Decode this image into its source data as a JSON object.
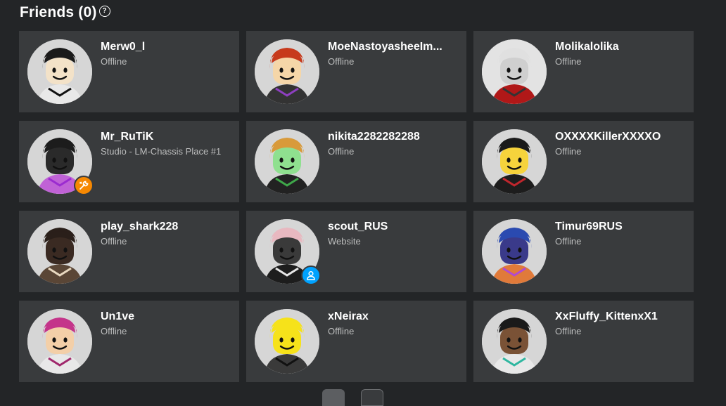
{
  "header": {
    "title": "Friends (0)",
    "help_glyph": "?"
  },
  "friends": [
    {
      "name": "Merw0_l",
      "status": "Offline",
      "badge": null,
      "avatar": {
        "bg": "#d6d6d6",
        "skin": "#f3e2c8",
        "hair": "#1a1a1a",
        "shirt": "#e8e8e8",
        "accent": "#111111"
      }
    },
    {
      "name": "MoeNastoyasheeIm...",
      "status": "Offline",
      "badge": null,
      "avatar": {
        "bg": "#d6d6d6",
        "skin": "#f5d6a8",
        "hair": "#c73a1c",
        "shirt": "#333333",
        "accent": "#8e3fc0"
      }
    },
    {
      "name": "Molikalolika",
      "status": "Offline",
      "badge": null,
      "avatar": {
        "bg": "#e3e3e3",
        "skin": "#cfcfcf",
        "hair": "#e0e0e0",
        "shirt": "#b01818",
        "accent": "#333333"
      }
    },
    {
      "name": "Mr_RuTiK",
      "status": "Studio - LM-Chassis Place #1",
      "badge": "studio",
      "avatar": {
        "bg": "#d6d6d6",
        "skin": "#2a2a2a",
        "hair": "#1c1c1c",
        "shirt": "#c062d6",
        "accent": "#9b2bd0"
      }
    },
    {
      "name": "nikita2282282288",
      "status": "Offline",
      "badge": null,
      "avatar": {
        "bg": "#d6d6d6",
        "skin": "#8fe08f",
        "hair": "#d89a3a",
        "shirt": "#222222",
        "accent": "#3fa84a"
      }
    },
    {
      "name": "OXXXXKillerXXXXO",
      "status": "Offline",
      "badge": null,
      "avatar": {
        "bg": "#d6d6d6",
        "skin": "#f6d33c",
        "hair": "#1a1a1a",
        "shirt": "#1d1d1d",
        "accent": "#c0262d"
      }
    },
    {
      "name": "play_shark228",
      "status": "Offline",
      "badge": null,
      "avatar": {
        "bg": "#d6d6d6",
        "skin": "#3a2a22",
        "hair": "#2a1f1a",
        "shirt": "#5a4636",
        "accent": "#e8d8c0"
      }
    },
    {
      "name": "scout_RUS",
      "status": "Website",
      "badge": "website",
      "avatar": {
        "bg": "#d6d6d6",
        "skin": "#3a3a3a",
        "hair": "#e8b8c0",
        "shirt": "#1d1d1d",
        "accent": "#e6e6e6"
      }
    },
    {
      "name": "Timur69RUS",
      "status": "Offline",
      "badge": null,
      "avatar": {
        "bg": "#d6d6d6",
        "skin": "#3a3a8a",
        "hair": "#2a4ab0",
        "shirt": "#e07a3a",
        "accent": "#b04ad0"
      }
    },
    {
      "name": "Un1ve",
      "status": "Offline",
      "badge": null,
      "avatar": {
        "bg": "#d6d6d6",
        "skin": "#f3cfa8",
        "hair": "#c4348a",
        "shirt": "#e8e8e8",
        "accent": "#a0286c"
      }
    },
    {
      "name": "xNeirax",
      "status": "Offline",
      "badge": null,
      "avatar": {
        "bg": "#d6d6d6",
        "skin": "#f6e21a",
        "hair": "#f6e21a",
        "shirt": "#3a3a3a",
        "accent": "#111111"
      }
    },
    {
      "name": "XxFluffy_KittenxX1",
      "status": "Offline",
      "badge": null,
      "avatar": {
        "bg": "#d6d6d6",
        "skin": "#7a5236",
        "hair": "#1a1a1a",
        "shirt": "#e8e8e8",
        "accent": "#2fb7a0"
      }
    }
  ],
  "badges": {
    "studio": {
      "icon": "wrench-icon"
    },
    "website": {
      "icon": "person-icon"
    }
  },
  "pager": {
    "prev_icon": "chevron-left-icon",
    "next_icon": "chevron-right-icon"
  }
}
